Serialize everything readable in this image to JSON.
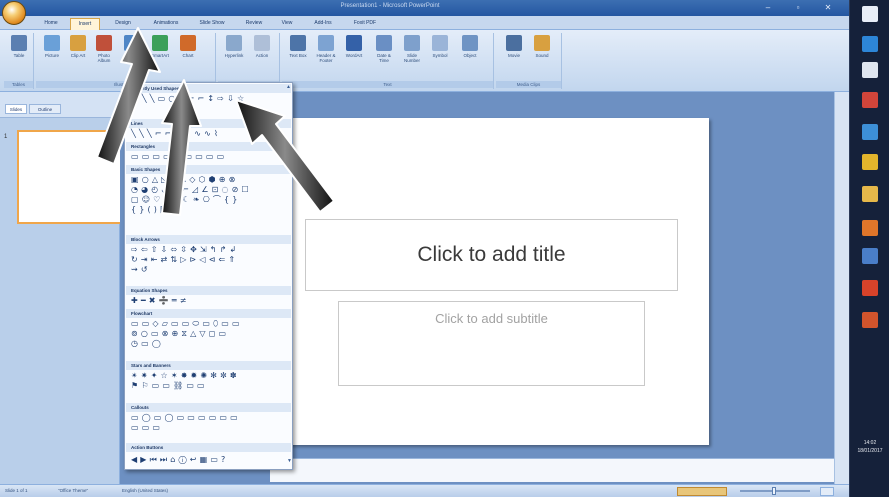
{
  "window": {
    "title": "Presentation1 - Microsoft PowerPoint",
    "controls": [
      "–",
      "▫",
      "✕"
    ]
  },
  "ribbon": {
    "tabs": [
      "Home",
      "Insert",
      "Design",
      "Animations",
      "Slide Show",
      "Review",
      "View",
      "Add-Ins",
      "Foxit PDF"
    ],
    "active_tab": "Insert",
    "groups": [
      {
        "label": "Tables",
        "buttons": [
          {
            "label": "Table",
            "icon": "table-icon",
            "color": "#5b7fb1"
          }
        ]
      },
      {
        "label": "Illustrations",
        "buttons": [
          {
            "label": "Picture",
            "icon": "picture-icon",
            "color": "#6aa0d8"
          },
          {
            "label": "Clip Art",
            "icon": "clip-art-icon",
            "color": "#d8a040"
          },
          {
            "label": "Photo Album",
            "icon": "photo-album-icon",
            "color": "#c0503a"
          },
          {
            "label": "Shapes",
            "icon": "shapes-icon",
            "color": "#4f86c6"
          },
          {
            "label": "SmartArt",
            "icon": "smartart-icon",
            "color": "#3ca05a"
          },
          {
            "label": "Chart",
            "icon": "chart-icon",
            "color": "#d06a2a"
          }
        ]
      },
      {
        "label": "Links",
        "buttons": [
          {
            "label": "Hyperlink",
            "icon": "hyperlink-icon",
            "color": "#8aa8cc"
          },
          {
            "label": "Action",
            "icon": "action-icon",
            "color": "#aebfd8"
          }
        ]
      },
      {
        "label": "Text",
        "buttons": [
          {
            "label": "Text Box",
            "icon": "text-box-icon",
            "color": "#4d74a8"
          },
          {
            "label": "Header & Footer",
            "icon": "header-footer-icon",
            "color": "#7da3d2"
          },
          {
            "label": "WordArt",
            "icon": "wordart-icon",
            "color": "#3461a8"
          },
          {
            "label": "Date & Time",
            "icon": "date-time-icon",
            "color": "#6a8fc4"
          },
          {
            "label": "Slide Number",
            "icon": "slide-number-icon",
            "color": "#7ea0cc"
          },
          {
            "label": "Symbol",
            "icon": "symbol-icon",
            "color": "#9ab4d8"
          },
          {
            "label": "Object",
            "icon": "object-icon",
            "color": "#6f94c4"
          }
        ]
      },
      {
        "label": "Media Clips",
        "buttons": [
          {
            "label": "Movie",
            "icon": "movie-icon",
            "color": "#4b6f9f"
          },
          {
            "label": "Sound",
            "icon": "sound-icon",
            "color": "#d8a040"
          }
        ]
      }
    ]
  },
  "outline_pane": {
    "tabs": [
      "Slides",
      "Outline"
    ],
    "slide_number": "1"
  },
  "slide": {
    "title_placeholder": "Click to add title",
    "subtitle_placeholder": "Click to add subtitle"
  },
  "status_bar": {
    "slide_info": "Slide 1 of 1",
    "theme": "\"Office Theme\"",
    "language": "English (United States)"
  },
  "shapes_gallery": {
    "sections": [
      {
        "label": "Recently Used Shapes",
        "rows": [
          "▭ ╲ ╲ ▭ ○ △ ⌐ ⌐ ↕ ⇨ ⇩ ☆"
        ]
      },
      {
        "label": "Lines",
        "rows": [
          "╲ ╲ ╲ ⌐ ⌐ ↳ ↳ ∿ ∿ ⌇"
        ]
      },
      {
        "label": "Rectangles",
        "rows": [
          "▭ ▭ ▭ ▭ ▭ ▭ ▭ ▭ ▭"
        ]
      },
      {
        "label": "Basic Shapes",
        "rows": [
          "▣ ○ △ ◺ ▱ ⏢ ◇ ⬡ ⬢ ⊕ ⊗",
          "◔ ◕ ◴ ◡ ▤ ⌐ ◿ ∠ ⊡ ◌ ⊘ ☐",
          "▢ ☺ ♡ ⚡ ☼ ☾ ❧ ⎔ ⌒ { }",
          "{ } ( ) [ ]"
        ]
      },
      {
        "label": "Block Arrows",
        "rows": [
          "⇨ ⇦ ⇧ ⇩ ⬄ ⇳ ✥ ⇲ ↰ ↱ ↲",
          "↻ ⇥ ⇤ ⇄ ⇅ ▷ ⊳ ◁ ⊲ ⇐ ⇑",
          "⇝ ↺"
        ]
      },
      {
        "label": "Equation Shapes",
        "rows": [
          "✚ ━ ✖ ➗ ═ ≠"
        ]
      },
      {
        "label": "Flowchart",
        "rows": [
          "▭ ▭ ◇ ▱ ▭ ▭ ⬭ ▭ ⬯ ▭ ▭",
          "⊚ ○ ▭ ⊗ ⊕ ⧖ △ ▽ ◻ ▭",
          "◷ ▭ ◯"
        ]
      },
      {
        "label": "Stars and Banners",
        "rows": [
          "✴ ✷ ✦ ☆ ✶ ✸ ✹ ✺ ✻ ✼ ✽",
          "⚑ ⚐ ▭ ▭ ⛓ ▭ ▭"
        ]
      },
      {
        "label": "Callouts",
        "rows": [
          "▭ ◯ ▭ ◯ ▭ ▭ ▭ ▭ ▭ ▭",
          "▭ ▭ ▭"
        ]
      },
      {
        "label": "Action Buttons",
        "rows": [
          "◀ ▶ ⏮ ⏭ ⌂ ⓘ ↩ ▦ ▭ ?"
        ]
      }
    ]
  },
  "taskbar": {
    "icons": [
      {
        "icon": "windows-icon",
        "color": "#e8eef8"
      },
      {
        "icon": "edge-icon",
        "color": "#2d86d8"
      },
      {
        "icon": "store-icon",
        "color": "#dfe5ef"
      },
      {
        "icon": "app-red-icon",
        "color": "#d2453a"
      },
      {
        "icon": "mail-icon",
        "color": "#3d8fd6"
      },
      {
        "icon": "chrome-icon",
        "color": "#e3b52c"
      },
      {
        "icon": "folder-icon",
        "color": "#e6b84a"
      },
      {
        "icon": "orange-app-icon",
        "color": "#e0762a"
      },
      {
        "icon": "monitor-icon",
        "color": "#4a7ec8"
      },
      {
        "icon": "office-icon",
        "color": "#d8432a"
      },
      {
        "icon": "powerpoint-icon",
        "color": "#d2542c"
      }
    ],
    "time": "14:02",
    "date": "18/01/2017"
  }
}
